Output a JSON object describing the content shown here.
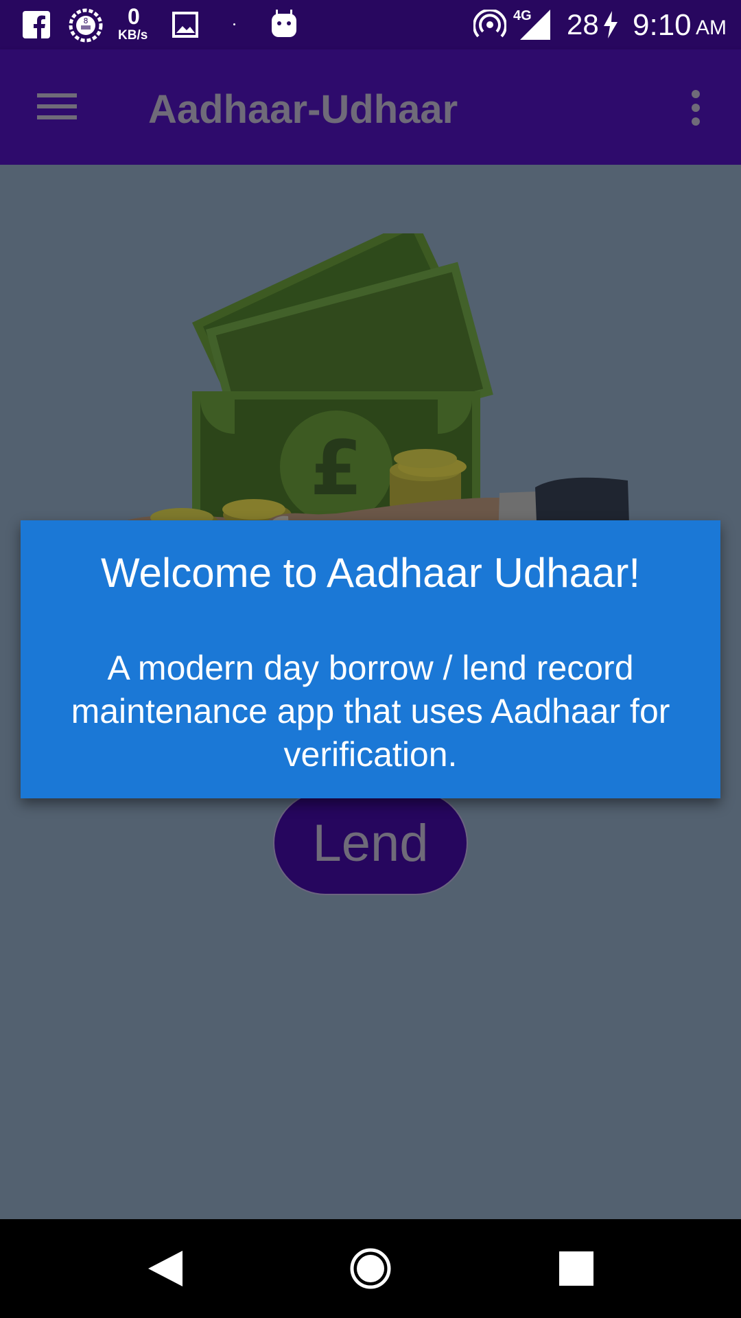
{
  "status_bar": {
    "data_speed_value": "0",
    "data_speed_unit": "KB/s",
    "network_type": "4G",
    "battery_level": "28",
    "time": "9:10",
    "am_pm": "AM",
    "icons": [
      "facebook-icon",
      "badge-icon",
      "gallery-icon",
      "dot-icon",
      "android-icon",
      "hotspot-icon",
      "signal-icon",
      "charging-icon"
    ]
  },
  "app_bar": {
    "title": "Aadhaar-Udhaar",
    "menu_icon": "hamburger-menu-icon",
    "overflow_icon": "more-vert-icon"
  },
  "main": {
    "illustration": "hand-holding-money",
    "lend_label": "Lend"
  },
  "dialog": {
    "title": "Welcome to Aadhaar Udhaar!",
    "message": "A modern day borrow / lend record maintenance app that uses Aadhaar for verification."
  },
  "nav_bar": {
    "icons": [
      "back-icon",
      "home-icon",
      "recents-icon"
    ]
  },
  "colors": {
    "status_bar": "#28075f",
    "app_bar": "#2e0b6c",
    "background_dimmed": "#536170",
    "dialog": "#1b78d6",
    "lend_button": "#26065e"
  }
}
